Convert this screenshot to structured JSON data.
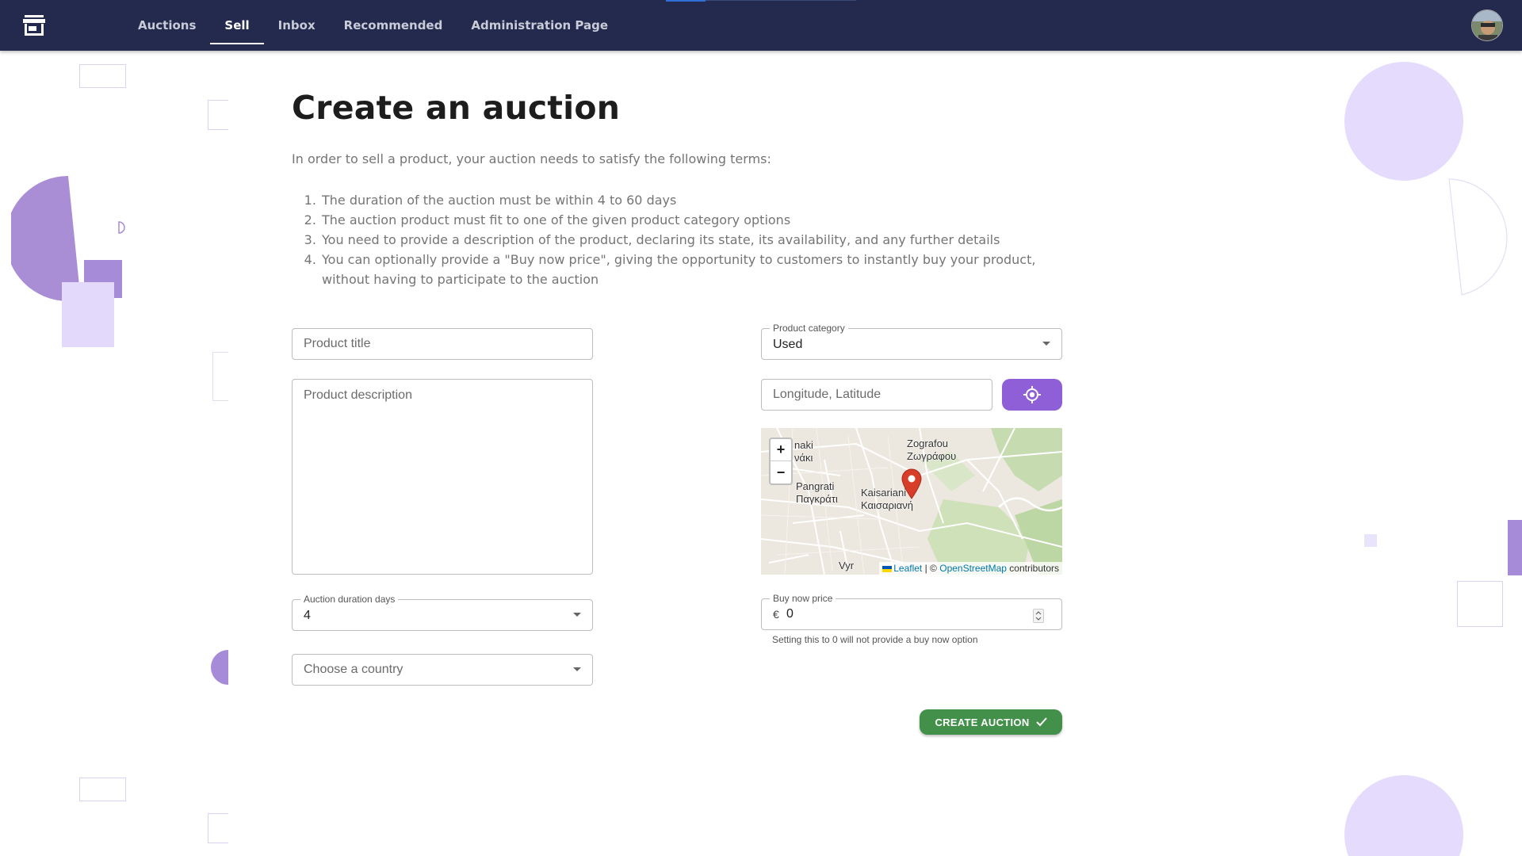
{
  "nav": {
    "tabs": [
      {
        "label": "Auctions"
      },
      {
        "label": "Sell"
      },
      {
        "label": "Inbox"
      },
      {
        "label": "Recommended"
      },
      {
        "label": "Administration Page"
      }
    ],
    "active_tab": "Sell"
  },
  "page": {
    "title": "Create an auction",
    "intro": "In order to sell a product, your auction needs to satisfy the following terms:",
    "terms": [
      "The duration of the auction must be within 4 to 60 days",
      "The auction product must fit to one of the given product category options",
      "You need to provide a description of the product, declaring its state, its availability, and any further details",
      "You can optionally provide a \"Buy now price\", giving the opportunity to customers to instantly buy your product, without having to participate to the auction"
    ]
  },
  "form": {
    "product_title": {
      "placeholder": "Product title"
    },
    "product_description": {
      "placeholder": "Product description"
    },
    "product_category": {
      "label": "Product category",
      "value": "Used"
    },
    "location": {
      "placeholder": "Longitude, Latitude"
    },
    "duration": {
      "label": "Auction duration days",
      "value": "4"
    },
    "country": {
      "placeholder": "Choose a country"
    },
    "buy_now": {
      "label": "Buy now price",
      "currency": "€",
      "value": "0",
      "helper": "Setting this to 0 will not provide a buy now option"
    },
    "submit_label": "CREATE AUCTION"
  },
  "map": {
    "labels": {
      "zografou_en": "Zografou",
      "zografou_gr": "Ζωγράφου",
      "pangrati_en": "Pangrati",
      "pangrati_gr": "Παγκράτι",
      "kaisariani_en": "Kaisariani",
      "kaisariani_gr": "Καισαριανή",
      "partial_top_1": "naki",
      "partial_top_2": "νάκι",
      "partial_bottom": "Vyr"
    },
    "zoom_in": "+",
    "zoom_out": "−",
    "attribution": {
      "leaflet": "Leaflet",
      "separator": "| ©",
      "osm": "OpenStreetMap",
      "suffix": "contributors"
    }
  },
  "colors": {
    "topbar": "#232a4e",
    "accent_purple": "#8e5fd6",
    "submit_green": "#43904a",
    "map_marker": "#d63e2a"
  }
}
